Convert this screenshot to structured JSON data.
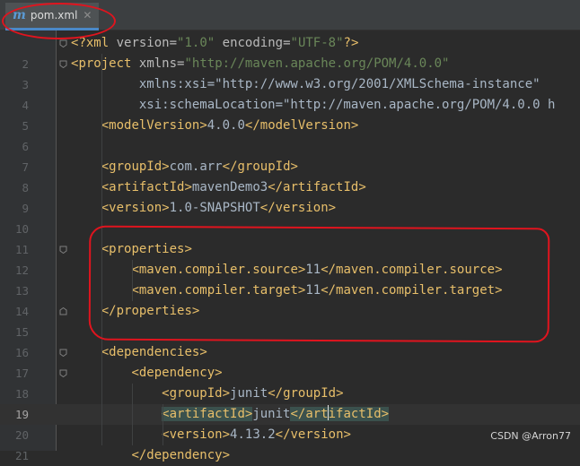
{
  "tab": {
    "label": "pom.xml",
    "icon": "maven-file-icon",
    "close": "✕"
  },
  "watermark": "CSDN @Arron77",
  "lines": [
    {
      "n": "",
      "code": "<?xml version=\"1.0\" encoding=\"UTF-8\"?>"
    },
    {
      "n": "2",
      "code": "<project xmlns=\"http://maven.apache.org/POM/4.0.0\""
    },
    {
      "n": "3",
      "code": "         xmlns:xsi=\"http://www.w3.org/2001/XMLSchema-instance\""
    },
    {
      "n": "4",
      "code": "         xsi:schemaLocation=\"http://maven.apache.org/POM/4.0.0 h"
    },
    {
      "n": "5",
      "code": "    <modelVersion>4.0.0</modelVersion>"
    },
    {
      "n": "6",
      "code": ""
    },
    {
      "n": "7",
      "code": "    <groupId>com.arr</groupId>"
    },
    {
      "n": "8",
      "code": "    <artifactId>mavenDemo3</artifactId>"
    },
    {
      "n": "9",
      "code": "    <version>1.0-SNAPSHOT</version>"
    },
    {
      "n": "10",
      "code": ""
    },
    {
      "n": "11",
      "code": "    <properties>"
    },
    {
      "n": "12",
      "code": "        <maven.compiler.source>11</maven.compiler.source>"
    },
    {
      "n": "13",
      "code": "        <maven.compiler.target>11</maven.compiler.target>"
    },
    {
      "n": "14",
      "code": "    </properties>"
    },
    {
      "n": "15",
      "code": ""
    },
    {
      "n": "16",
      "code": "    <dependencies>"
    },
    {
      "n": "17",
      "code": "        <dependency>"
    },
    {
      "n": "18",
      "code": "            <groupId>junit</groupId>"
    },
    {
      "n": "19",
      "code": "            <artifactId>junit</artifactId>"
    },
    {
      "n": "20",
      "code": "            <version>4.13.2</version>"
    },
    {
      "n": "21",
      "code": "        </dependency>"
    }
  ],
  "caret_line": "19",
  "colors": {
    "background": "#2b2b2b",
    "tag": "#e8bf6a",
    "attribute_value": "#6a8759",
    "namespace": "#9876aa",
    "annotation": "#e0141e"
  }
}
